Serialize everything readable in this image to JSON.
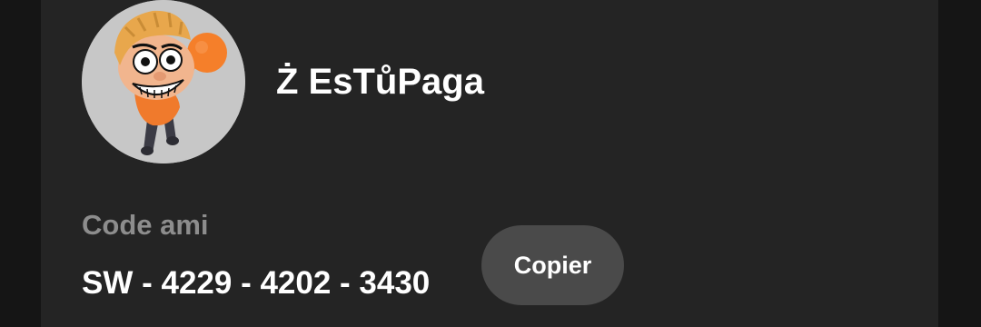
{
  "profile": {
    "name": "Ż EsTůPaga",
    "avatar_icon": "mii-avatar"
  },
  "friend_code": {
    "label": "Code ami",
    "value": "SW - 4229 - 4202 - 3430",
    "copy_label": "Copier"
  },
  "colors": {
    "background": "#151515",
    "card": "#242424",
    "label": "#8d8d8d",
    "text": "#ffffff",
    "button": "#4a4a4a",
    "avatar_bg": "#c7c7c7"
  }
}
